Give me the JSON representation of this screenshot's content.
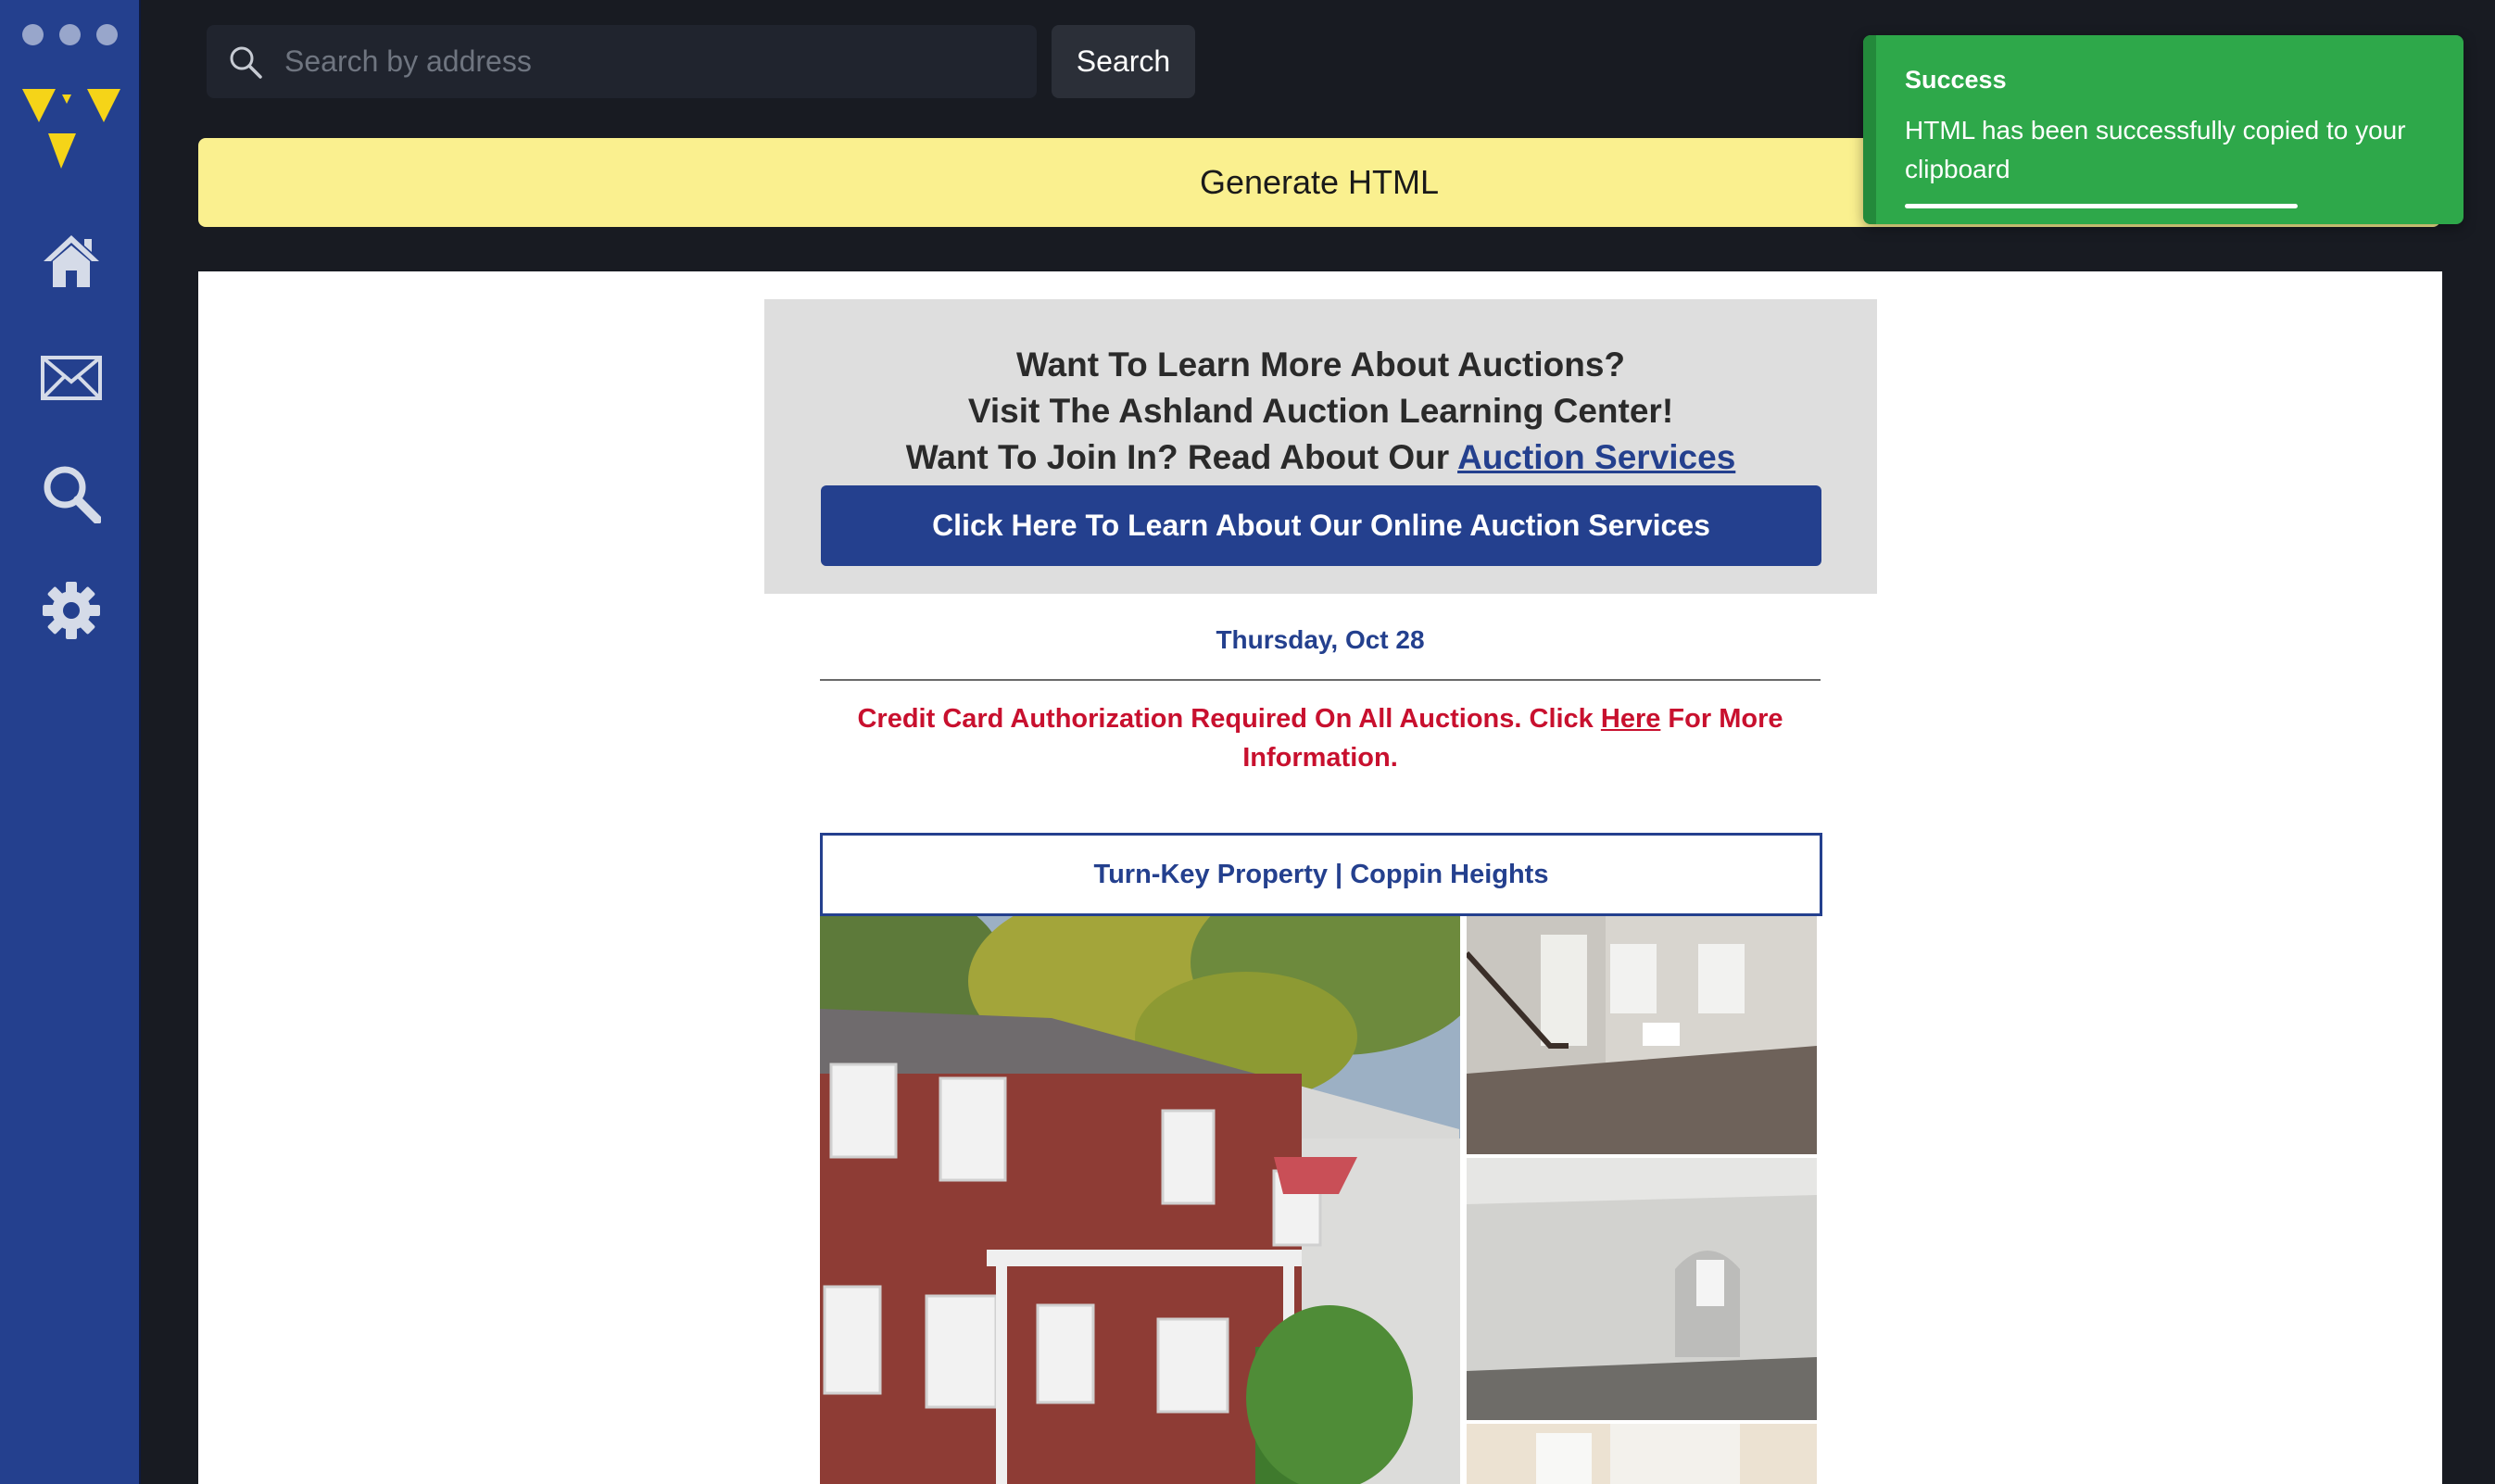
{
  "search": {
    "placeholder": "Search by address",
    "button_label": "Search"
  },
  "generate": {
    "label": "Generate HTML"
  },
  "toast": {
    "title": "Success",
    "message": "HTML has been successfully copied to your clipboard"
  },
  "sidebar": {
    "icons": [
      "home-icon",
      "mail-icon",
      "search-icon",
      "gear-icon"
    ]
  },
  "email": {
    "promo": {
      "line1": "Want To Learn More About Auctions?",
      "line2": "Visit The Ashland Auction Learning Center!",
      "line3_prefix": "Want To Join In? Read About Our ",
      "line3_link": "Auction Services",
      "button_label": "Click Here To Learn About Our Online Auction Services"
    },
    "date": "Thursday, Oct 28",
    "notice": {
      "prefix": "Credit Card Authorization Required On All Auctions. Click ",
      "link": "Here",
      "suffix": " For More Information."
    },
    "property_title": "Turn-Key Property | Coppin Heights"
  },
  "colors": {
    "sidebar": "#24408e",
    "background": "#181b22",
    "generate_bar": "#faf08f",
    "toast": "#2ea84a",
    "accent_blue": "#24408e",
    "notice_red": "#c8102e"
  }
}
